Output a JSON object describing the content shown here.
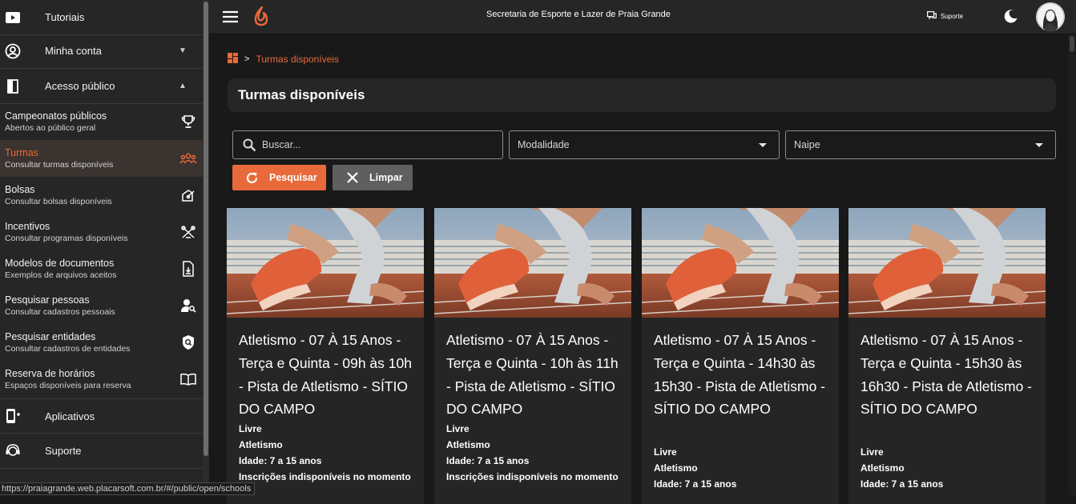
{
  "sidebar": {
    "tutoriais": "Tutoriais",
    "minha_conta": "Minha conta",
    "acesso_publico": "Acesso público",
    "items": [
      {
        "title": "Campeonatos públicos",
        "subtitle": "Abertos ao público geral",
        "icon": "trophy-icon"
      },
      {
        "title": "Turmas",
        "subtitle": "Consultar turmas disponíveis",
        "icon": "group-icon"
      },
      {
        "title": "Bolsas",
        "subtitle": "Consultar bolsas disponíveis",
        "icon": "scholarship-icon"
      },
      {
        "title": "Incentivos",
        "subtitle": "Consultar programas disponíveis",
        "icon": "incentive-icon"
      },
      {
        "title": "Modelos de documentos",
        "subtitle": "Exemplos de arquivos aceitos",
        "icon": "document-icon"
      },
      {
        "title": "Pesquisar pessoas",
        "subtitle": "Consultar cadastros pessoais",
        "icon": "person-search-icon"
      },
      {
        "title": "Pesquisar entidades",
        "subtitle": "Consultar cadastros de entidades",
        "icon": "shield-search-icon"
      },
      {
        "title": "Reserva de horários",
        "subtitle": "Espaços disponíveis para reserva",
        "icon": "book-icon"
      }
    ],
    "aplicativos": "Aplicativos",
    "suporte": "Suporte"
  },
  "topbar": {
    "title": "Secretaria de Esporte e Lazer de Praia Grande",
    "support_label": "Suporte"
  },
  "breadcrumb": {
    "separator": ">",
    "current": "Turmas disponíveis"
  },
  "page_title": "Turmas disponíveis",
  "filters": {
    "search_placeholder": "Buscar...",
    "modalidade": "Modalidade",
    "naipe": "Naipe",
    "search_button": "Pesquisar",
    "clear_button": "Limpar"
  },
  "cards": [
    {
      "title": "Atletismo - 07 À 15 Anos - Terça e Quinta - 09h às 10h - Pista de Atletismo - SÍTIO DO CAMPO",
      "naipe": "Livre",
      "modalidade": "Atletismo",
      "idade": "Idade: 7 a 15 anos",
      "status": "Inscrições indisponíveis no momento"
    },
    {
      "title": "Atletismo - 07 À 15 Anos - Terça e Quinta - 10h às 11h - Pista de Atletismo - SÍTIO DO CAMPO",
      "naipe": "Livre",
      "modalidade": "Atletismo",
      "idade": "Idade: 7 a 15 anos",
      "status": "Inscrições indisponíveis no momento"
    },
    {
      "title": "Atletismo - 07 À 15 Anos - Terça e Quinta - 14h30 às 15h30 - Pista de Atletismo - SÍTIO DO CAMPO",
      "naipe": "Livre",
      "modalidade": "Atletismo",
      "idade": "Idade: 7 a 15 anos",
      "status": ""
    },
    {
      "title": "Atletismo - 07 À 15 Anos - Terça e Quinta - 15h30 às 16h30 - Pista de Atletismo - SÍTIO DO CAMPO",
      "naipe": "Livre",
      "modalidade": "Atletismo",
      "idade": "Idade: 7 a 15 anos",
      "status": ""
    }
  ],
  "status_url": "https://praiagrande.web.placarsoft.com.br/#/public/open/schools",
  "colors": {
    "accent": "#e8693a",
    "sidebar": "#262626",
    "background": "#191919"
  }
}
